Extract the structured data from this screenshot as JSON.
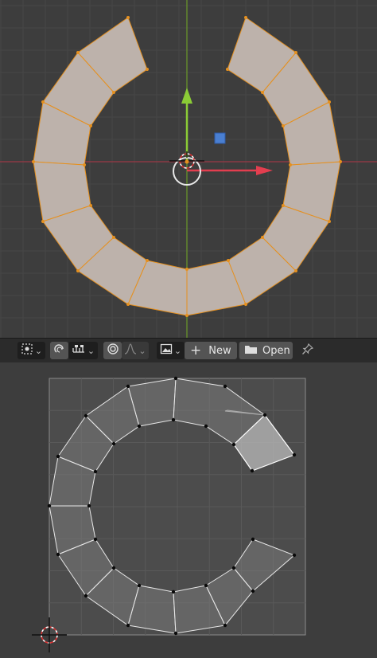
{
  "toolbar": {
    "new_label": "New",
    "open_label": "Open",
    "new_icon": "plus-icon",
    "open_icon": "folder-icon",
    "pin_icon": "pin-icon",
    "sync_icon": "uv-sync-selection-icon",
    "snap_icon": "snap-icon",
    "proportional_icon": "proportional-editing-icon",
    "falloff_icon": "falloff-curve-icon",
    "image_icon": "image-browse-icon",
    "pivot_icon": "pivot-point-icon"
  },
  "colors": {
    "viewport_bg": "#3d3d3d",
    "grid_line": "#464646",
    "mesh_face": "#bdb2ab",
    "mesh_edge": "#e5901f",
    "x_axis": "#9a3a45",
    "y_axis": "#6a9a2a",
    "gizmo_x": "#e33e4f",
    "gizmo_y": "#8bcc36",
    "gizmo_z": "#4a7fd1",
    "uv_bg": "#4c4c4c",
    "uv_face": "#777777",
    "uv_selected_face": "#bbbbbb"
  }
}
